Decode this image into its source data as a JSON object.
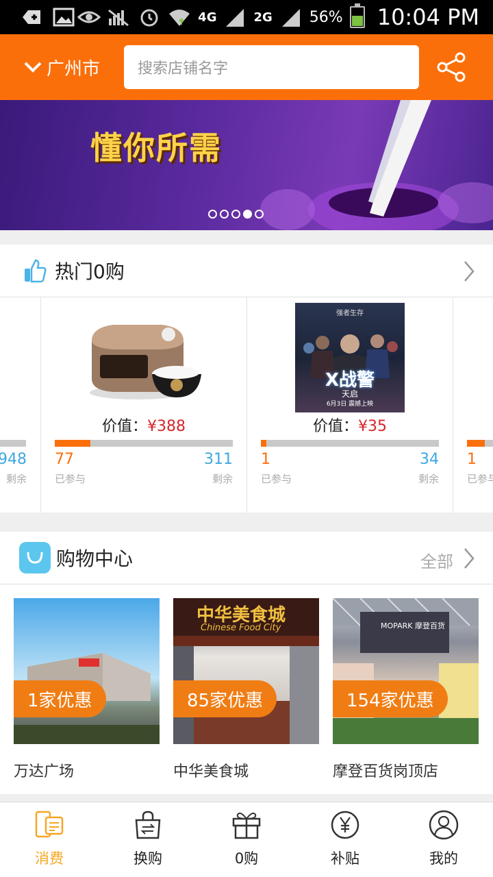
{
  "status_bar": {
    "signal_4g_a": "4G",
    "signal_4g_b": "4G",
    "signal_2g": "2G",
    "battery": "56%",
    "time": "10:04 PM"
  },
  "header": {
    "city": "广州市",
    "search_placeholder": "搜索店铺名字"
  },
  "banner": {
    "headline": "懂你所需",
    "slide_count": 5,
    "active_slide": 4
  },
  "hot_section": {
    "title": "热门0购",
    "cards": [
      {
        "partial_right_num": "948",
        "partial_right_label": "剩余"
      },
      {
        "price_label": "价值：",
        "price": "¥388",
        "joined": "77",
        "joined_label": "已参与",
        "remaining": "311",
        "remaining_label": "剩余",
        "progress": 0.2
      },
      {
        "price_label": "价值：",
        "price": "¥35",
        "joined": "1",
        "joined_label": "已参与",
        "remaining": "34",
        "remaining_label": "剩余",
        "progress": 0.03,
        "poster_title": "X战警",
        "poster_sub": "天启",
        "poster_top": "强者生存",
        "poster_date": "6月3日 震撼上映"
      },
      {
        "joined": "1",
        "joined_label": "已参与"
      }
    ]
  },
  "shopping_section": {
    "title": "购物中心",
    "all_label": "全部",
    "malls": [
      {
        "badge": "1家优惠",
        "name": "万达广场"
      },
      {
        "badge": "85家优惠",
        "name": "中华美食城",
        "sign": "中华美食城",
        "sign_en": "Chinese Food City"
      },
      {
        "badge": "154家优惠",
        "name": "摩登百货岗顶店",
        "sign": "MOPARK 摩登百货"
      }
    ]
  },
  "bottom_nav": [
    {
      "label": "消费",
      "icon": "phone-card-icon",
      "active": true
    },
    {
      "label": "换购",
      "icon": "exchange-bag-icon",
      "active": false
    },
    {
      "label": "0购",
      "icon": "gift-icon",
      "active": false
    },
    {
      "label": "补贴",
      "icon": "yuan-coin-icon",
      "active": false
    },
    {
      "label": "我的",
      "icon": "user-icon",
      "active": false
    }
  ],
  "colors": {
    "brand": "#fb6f0b",
    "price": "#d4272b",
    "remaining": "#3ea7e0",
    "active_tab": "#f5a623"
  }
}
